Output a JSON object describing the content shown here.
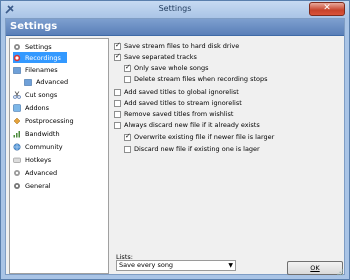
{
  "window": {
    "title": "Settings",
    "close_label": "✕"
  },
  "header": {
    "title": "Settings"
  },
  "sidebar": {
    "items": [
      {
        "label": "Settings",
        "icon": "gear-icon"
      },
      {
        "label": "Recordings",
        "icon": "record-icon",
        "selected": true
      },
      {
        "label": "Filenames",
        "icon": "folder-icon"
      },
      {
        "label": "Advanced",
        "icon": "folder-advanced-icon"
      },
      {
        "label": "Cut songs",
        "icon": "scissors-icon"
      },
      {
        "label": "Addons",
        "icon": "addons-icon"
      },
      {
        "label": "Postprocessing",
        "icon": "postprocessing-icon"
      },
      {
        "label": "Bandwidth",
        "icon": "bandwidth-icon"
      },
      {
        "label": "Community",
        "icon": "community-icon"
      },
      {
        "label": "Hotkeys",
        "icon": "hotkeys-icon"
      },
      {
        "label": "Advanced",
        "icon": "advanced-icon"
      },
      {
        "label": "General",
        "icon": "general-icon"
      }
    ]
  },
  "options": [
    {
      "label": "Save stream files to hard disk drive",
      "checked": true
    },
    {
      "label": "Save separated tracks",
      "checked": true
    },
    {
      "label": "Only save whole songs",
      "checked": true
    },
    {
      "label": "Delete stream files when recording stops",
      "checked": false
    },
    {
      "label": "Add saved titles to global ignorelist",
      "checked": false
    },
    {
      "label": "Add saved titles to stream ignorelist",
      "checked": false
    },
    {
      "label": "Remove saved titles from wishlist",
      "checked": false
    },
    {
      "label": "Always discard new file if it already exists",
      "checked": false
    },
    {
      "label": "Overwrite existing file if newer file is larger",
      "checked": true
    },
    {
      "label": "Discard new file if existing one is lager",
      "checked": false
    }
  ],
  "lists": {
    "label": "Lists:",
    "selected": "Save every song"
  },
  "footer": {
    "ok_label": "OK"
  }
}
